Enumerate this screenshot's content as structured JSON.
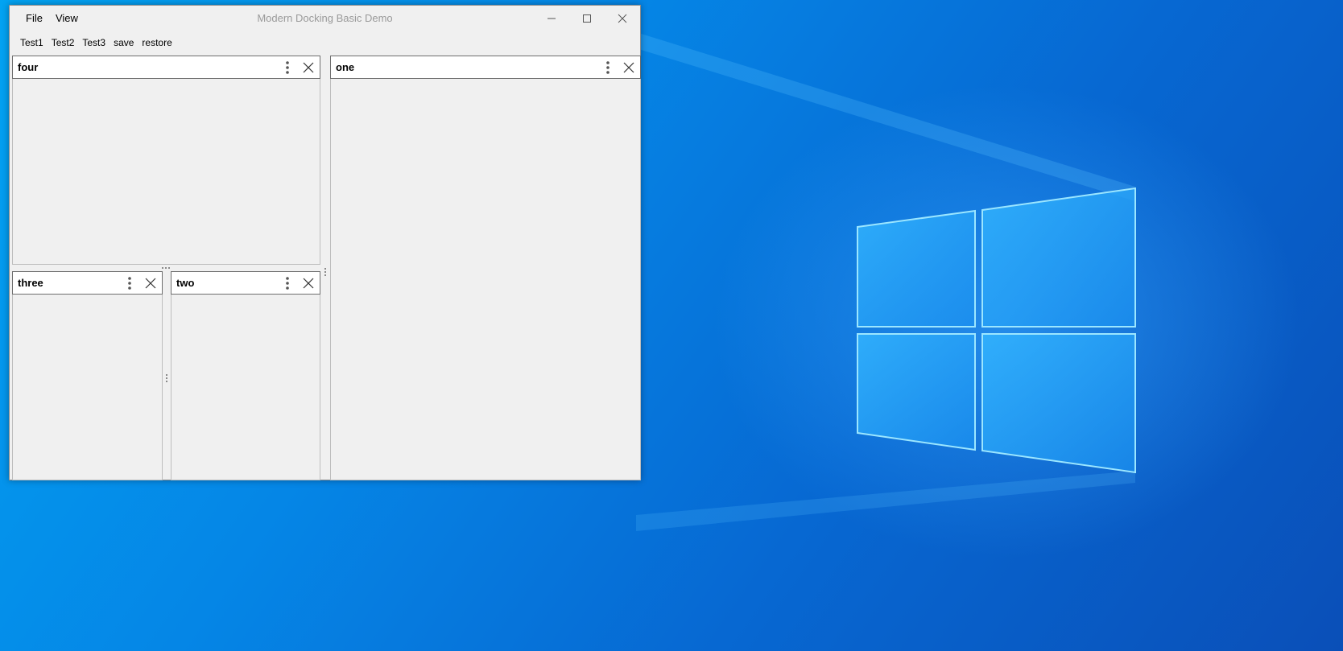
{
  "window": {
    "title": "Modern Docking Basic Demo",
    "menu": [
      "File",
      "View"
    ],
    "controls": {
      "minimize": "minimize-icon",
      "maximize": "maximize-icon",
      "close": "close-icon"
    }
  },
  "toolbar": {
    "items": [
      "Test1",
      "Test2",
      "Test3",
      "save",
      "restore"
    ]
  },
  "panels": {
    "four": {
      "title": "four"
    },
    "one": {
      "title": "one"
    },
    "three": {
      "title": "three"
    },
    "two": {
      "title": "two"
    }
  },
  "icons": {
    "panel_menu": "vertical-ellipsis-icon",
    "panel_close": "close-icon"
  },
  "colors": {
    "window_bg": "#f0f0f0",
    "header_bg": "#ffffff",
    "title_gray": "#9a9a9a",
    "desktop_blue": "#0768d2"
  }
}
